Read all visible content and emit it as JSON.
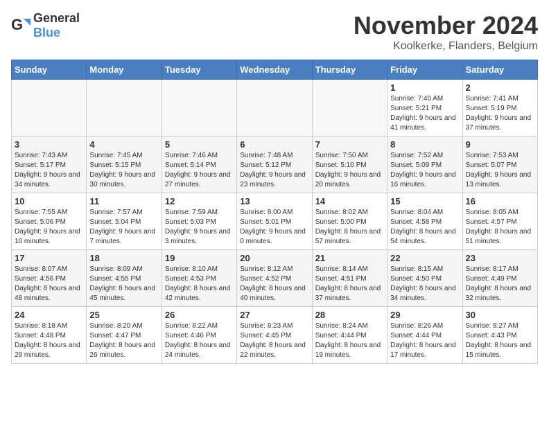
{
  "logo": {
    "text_general": "General",
    "text_blue": "Blue"
  },
  "header": {
    "month_title": "November 2024",
    "location": "Koolkerke, Flanders, Belgium"
  },
  "weekdays": [
    "Sunday",
    "Monday",
    "Tuesday",
    "Wednesday",
    "Thursday",
    "Friday",
    "Saturday"
  ],
  "weeks": [
    [
      {
        "day": "",
        "info": ""
      },
      {
        "day": "",
        "info": ""
      },
      {
        "day": "",
        "info": ""
      },
      {
        "day": "",
        "info": ""
      },
      {
        "day": "",
        "info": ""
      },
      {
        "day": "1",
        "info": "Sunrise: 7:40 AM\nSunset: 5:21 PM\nDaylight: 9 hours and 41 minutes."
      },
      {
        "day": "2",
        "info": "Sunrise: 7:41 AM\nSunset: 5:19 PM\nDaylight: 9 hours and 37 minutes."
      }
    ],
    [
      {
        "day": "3",
        "info": "Sunrise: 7:43 AM\nSunset: 5:17 PM\nDaylight: 9 hours and 34 minutes."
      },
      {
        "day": "4",
        "info": "Sunrise: 7:45 AM\nSunset: 5:15 PM\nDaylight: 9 hours and 30 minutes."
      },
      {
        "day": "5",
        "info": "Sunrise: 7:46 AM\nSunset: 5:14 PM\nDaylight: 9 hours and 27 minutes."
      },
      {
        "day": "6",
        "info": "Sunrise: 7:48 AM\nSunset: 5:12 PM\nDaylight: 9 hours and 23 minutes."
      },
      {
        "day": "7",
        "info": "Sunrise: 7:50 AM\nSunset: 5:10 PM\nDaylight: 9 hours and 20 minutes."
      },
      {
        "day": "8",
        "info": "Sunrise: 7:52 AM\nSunset: 5:09 PM\nDaylight: 9 hours and 16 minutes."
      },
      {
        "day": "9",
        "info": "Sunrise: 7:53 AM\nSunset: 5:07 PM\nDaylight: 9 hours and 13 minutes."
      }
    ],
    [
      {
        "day": "10",
        "info": "Sunrise: 7:55 AM\nSunset: 5:06 PM\nDaylight: 9 hours and 10 minutes."
      },
      {
        "day": "11",
        "info": "Sunrise: 7:57 AM\nSunset: 5:04 PM\nDaylight: 9 hours and 7 minutes."
      },
      {
        "day": "12",
        "info": "Sunrise: 7:59 AM\nSunset: 5:03 PM\nDaylight: 9 hours and 3 minutes."
      },
      {
        "day": "13",
        "info": "Sunrise: 8:00 AM\nSunset: 5:01 PM\nDaylight: 9 hours and 0 minutes."
      },
      {
        "day": "14",
        "info": "Sunrise: 8:02 AM\nSunset: 5:00 PM\nDaylight: 8 hours and 57 minutes."
      },
      {
        "day": "15",
        "info": "Sunrise: 8:04 AM\nSunset: 4:58 PM\nDaylight: 8 hours and 54 minutes."
      },
      {
        "day": "16",
        "info": "Sunrise: 8:05 AM\nSunset: 4:57 PM\nDaylight: 8 hours and 51 minutes."
      }
    ],
    [
      {
        "day": "17",
        "info": "Sunrise: 8:07 AM\nSunset: 4:56 PM\nDaylight: 8 hours and 48 minutes."
      },
      {
        "day": "18",
        "info": "Sunrise: 8:09 AM\nSunset: 4:55 PM\nDaylight: 8 hours and 45 minutes."
      },
      {
        "day": "19",
        "info": "Sunrise: 8:10 AM\nSunset: 4:53 PM\nDaylight: 8 hours and 42 minutes."
      },
      {
        "day": "20",
        "info": "Sunrise: 8:12 AM\nSunset: 4:52 PM\nDaylight: 8 hours and 40 minutes."
      },
      {
        "day": "21",
        "info": "Sunrise: 8:14 AM\nSunset: 4:51 PM\nDaylight: 8 hours and 37 minutes."
      },
      {
        "day": "22",
        "info": "Sunrise: 8:15 AM\nSunset: 4:50 PM\nDaylight: 8 hours and 34 minutes."
      },
      {
        "day": "23",
        "info": "Sunrise: 8:17 AM\nSunset: 4:49 PM\nDaylight: 8 hours and 32 minutes."
      }
    ],
    [
      {
        "day": "24",
        "info": "Sunrise: 8:18 AM\nSunset: 4:48 PM\nDaylight: 8 hours and 29 minutes."
      },
      {
        "day": "25",
        "info": "Sunrise: 8:20 AM\nSunset: 4:47 PM\nDaylight: 8 hours and 26 minutes."
      },
      {
        "day": "26",
        "info": "Sunrise: 8:22 AM\nSunset: 4:46 PM\nDaylight: 8 hours and 24 minutes."
      },
      {
        "day": "27",
        "info": "Sunrise: 8:23 AM\nSunset: 4:45 PM\nDaylight: 8 hours and 22 minutes."
      },
      {
        "day": "28",
        "info": "Sunrise: 8:24 AM\nSunset: 4:44 PM\nDaylight: 8 hours and 19 minutes."
      },
      {
        "day": "29",
        "info": "Sunrise: 8:26 AM\nSunset: 4:44 PM\nDaylight: 8 hours and 17 minutes."
      },
      {
        "day": "30",
        "info": "Sunrise: 8:27 AM\nSunset: 4:43 PM\nDaylight: 8 hours and 15 minutes."
      }
    ]
  ]
}
